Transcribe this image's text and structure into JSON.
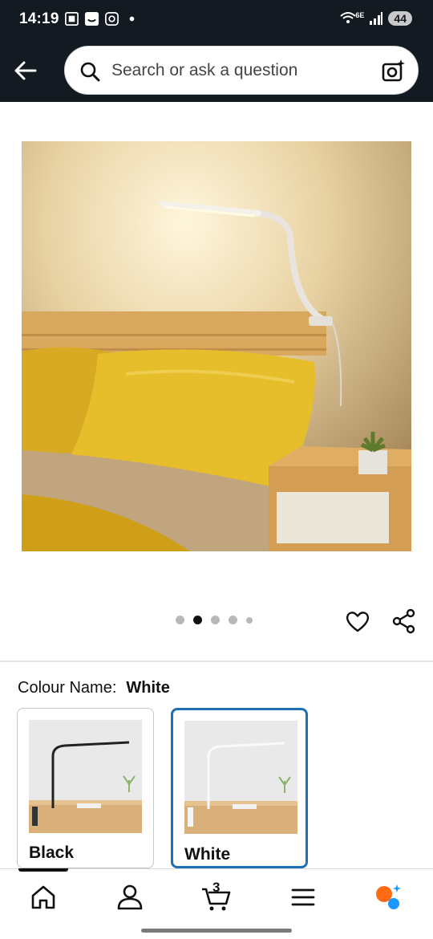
{
  "status": {
    "time": "14:19",
    "network": "6E",
    "battery": "44"
  },
  "search": {
    "placeholder": "Search or ask a question"
  },
  "carousel": {
    "dot_count": 5,
    "active_index": 1
  },
  "variation": {
    "label": "Colour Name:",
    "selected": "White",
    "options": [
      {
        "name": "Black"
      },
      {
        "name": "White"
      }
    ]
  },
  "nav": {
    "cart_count": "3"
  },
  "colors": {
    "header": "#131a22",
    "selected_border": "#1f6fb3"
  }
}
